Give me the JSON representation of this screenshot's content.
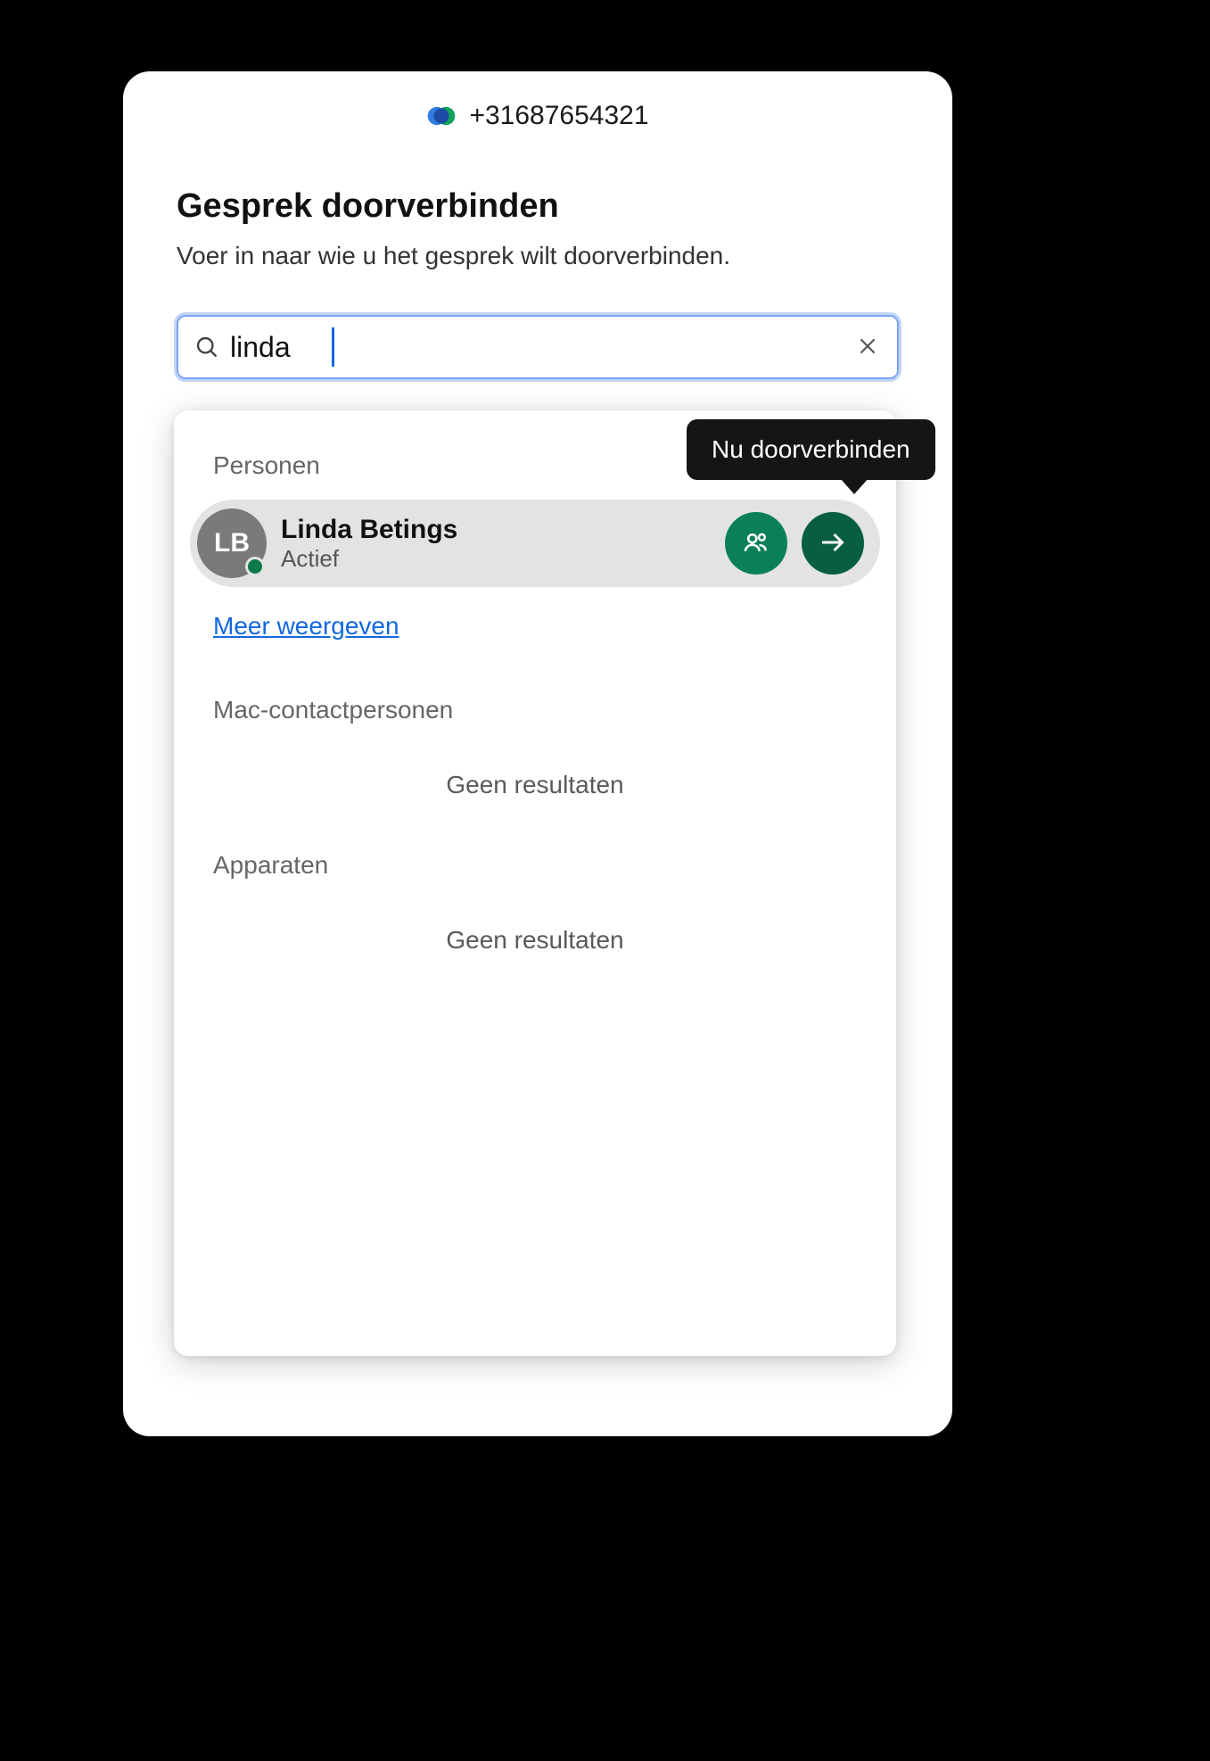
{
  "titlebar": {
    "icon_name": "webex-logo-icon",
    "phone_number": "+31687654321"
  },
  "header": {
    "title": "Gesprek doorverbinden",
    "subtitle": "Voer in naar wie u het gesprek wilt doorverbinden."
  },
  "search": {
    "value": "linda",
    "clear_label": "Clear",
    "placeholder": ""
  },
  "tooltip": {
    "transfer_now": "Nu doorverbinden"
  },
  "dropdown": {
    "sections": {
      "people": {
        "label": "Personen",
        "show_more": "Meer weergeven",
        "results": [
          {
            "initials": "LB",
            "name": "Linda Betings",
            "status": "Actief",
            "presence": "active"
          }
        ]
      },
      "mac_contacts": {
        "label": "Mac-contactpersonen",
        "no_results": "Geen resultaten"
      },
      "devices": {
        "label": "Apparaten",
        "no_results": "Geen resultaten"
      }
    }
  },
  "colors": {
    "accent": "#1268e0",
    "action_green": "#0a805a",
    "action_green_dark": "#075e42",
    "presence_active": "#0b7a4b"
  }
}
